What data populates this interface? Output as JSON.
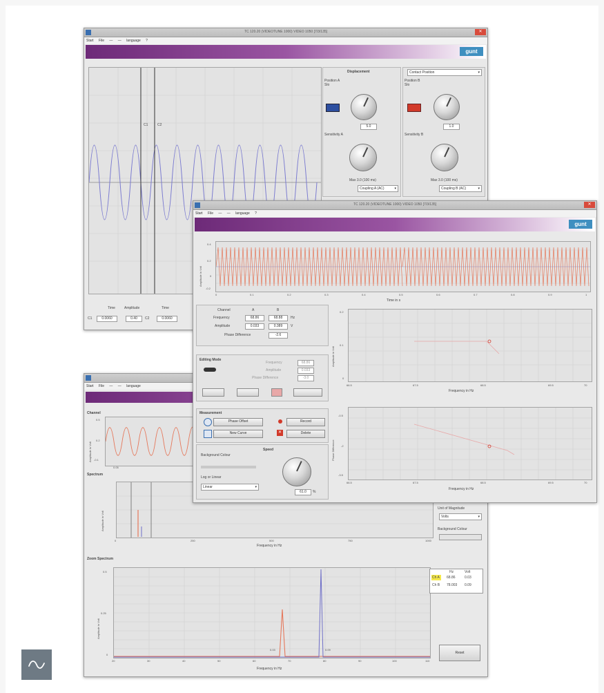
{
  "back_window": {
    "title": "TC 120.20 (VIDEOTUNE 1000) VIDEO 1050 [7/3/135]",
    "menu": [
      "Start",
      "File",
      "",
      "",
      "language",
      "?"
    ],
    "logo": "gunt",
    "displacement_title": "Displacement",
    "contact_title": "Contact Position",
    "position_a_label": "Position A\nSlo",
    "position_b_label": "Position B\nSlo",
    "sensitivity_a_label": "Sensitivity A",
    "sensitivity_b_label": "Sensitivity B",
    "knob_a_value": "5.0",
    "knob_b_value": "1.0",
    "max_label": "Max 3.0 (100 ms)",
    "coupling_a": "Coupling A (AC)",
    "coupling_b": "Coupling B (AC)",
    "time_label": "Time",
    "amplitude_label": "Amplitude",
    "cursor_1_time": "0.0060",
    "cursor_1_amp": "0.40",
    "cursor_2_time": "0.0060",
    "cursor_1_label": "C1",
    "cursor_2_label": "C2",
    "cursor_1_marker": "C1",
    "cursor_2_marker": "C2"
  },
  "middle_window": {
    "title": "TC 120.20 (VIDEOTUNE 1000) VIDEO 1050 [7/3/135]",
    "menu": [
      "Start",
      "File",
      "",
      "",
      "language",
      "?"
    ],
    "logo": "gunt",
    "time_axis_label": "Time in s",
    "time_ylabel": "Amplitude in Volt",
    "time_ticks": [
      "0",
      "0.05",
      "0.1",
      "0.15",
      "0.2",
      "0.25",
      "0.3",
      "0.35",
      "0.4",
      "0.45",
      "0.5",
      "0.55",
      "0.6",
      "0.65",
      "0.7",
      "0.75",
      "0.8",
      "0.85",
      "0.9",
      "0.95",
      "1"
    ],
    "time_yticks": [
      "0.4",
      "0.3",
      "0.2",
      "0.1",
      "0",
      "-0.1",
      "-0.2"
    ],
    "channel_label": "Channel",
    "channel_a": "A",
    "channel_b": "B",
    "frequency_label": "Frequency",
    "freq_a": "68.86",
    "freq_b": "68.88",
    "freq_unit": "Hz",
    "amplitude_label": "Amplitude",
    "amp_a": "0.033",
    "amp_b": "0.389",
    "amp_unit": "V",
    "phase_label": "Phase Difference",
    "phase_value": "-2.6",
    "fitting_title": "Editing Mode",
    "fit_frequency_label": "Frequency",
    "fit_frequency_value": "68.86",
    "fit_amplitude_label": "Amplitude",
    "fit_amplitude_value": "0.033",
    "fit_phase_label": "Phase Difference",
    "fit_phase_value": "-3.0",
    "measurement_title": "Measurement",
    "btn_phase_offset": "Phase Offset",
    "btn_new_curve": "New Curve",
    "btn_record": "Record",
    "btn_delete": "Delete",
    "background_colour_label": "Background Colour",
    "lin_log_label": "Log or Linear",
    "lin_log_value": "Linear",
    "speed_title": "Speed",
    "speed_value": "61.0",
    "speed_unit": "%",
    "amp_plot_ylabel": "Amplitude in Volt",
    "amp_plot_xlabel": "Frequency in Hz",
    "phase_plot_ylabel": "Phase Difference",
    "phase_plot_xlabel": "Frequency in Hz",
    "freq_ticks": [
      "66.5",
      "66.75",
      "67",
      "67.25",
      "67.5",
      "67.75",
      "68",
      "68.25",
      "68.5",
      "68.75",
      "69",
      "69.25",
      "69.5",
      "69.75",
      "70"
    ],
    "amp_yticks": [
      "0.2",
      "0.15",
      "0.1",
      "0.05",
      "0"
    ],
    "phase_yticks": [
      "-0.5",
      "-1",
      "-1.5",
      "-2",
      "-2.5",
      "-3",
      "-3.5"
    ]
  },
  "front_window": {
    "title": "TC 120.20 (VIDEOTUNE 1000) VIDEO 1050 [7/3/135]",
    "menu": [
      "Start",
      "File",
      "",
      "",
      "language",
      "?"
    ],
    "channel_title": "Channel",
    "channel_ylabel": "Amplitude in Volt",
    "channel_yticks": [
      "0.5",
      "0.4",
      "0.3",
      "0.2",
      "0.1",
      "0",
      "-0.1"
    ],
    "channel_xtick_start": "0.05",
    "spectrum_title": "Spectrum",
    "spectrum_ylabel": "Amplitude in Volt",
    "spectrum_xlabel": "Frequency in Hz",
    "spectrum_ticks": [
      "0",
      "50",
      "100",
      "150",
      "200",
      "250",
      "300",
      "350",
      "400",
      "450",
      "500",
      "550",
      "600",
      "650",
      "700",
      "750",
      "800",
      "850",
      "900",
      "950",
      "1000"
    ],
    "unit_magnitude_label": "Unit of Magnitude",
    "unit_magnitude_value": "Volts",
    "background_colour_label": "Background Colour",
    "zoom_title": "Zoom Spectrum",
    "zoom_ylabel": "Amplitude in Volt",
    "zoom_xlabel": "Frequency in Hz",
    "zoom_ticks": [
      "20",
      "30",
      "40",
      "50",
      "60",
      "70",
      "80",
      "90",
      "100",
      "110"
    ],
    "zoom_yticks": [
      "0.5",
      "0.45",
      "0.4",
      "0.35",
      "0.3",
      "0.25",
      "0.2",
      "0.15",
      "0.1",
      "0.05",
      "0"
    ],
    "legend_col_hz": "Hz",
    "legend_col_volt": "Volt",
    "legend_row_a_ch": "Ch A",
    "legend_row_a_hz": "68.86",
    "legend_row_a_volt": "0.03",
    "legend_row_b_ch": "Ch B",
    "legend_row_b_hz": "78.003",
    "legend_row_b_volt": "0.09",
    "reset_button": "Reset",
    "peak_label_a": "0.03",
    "peak_label_b": "0.09"
  },
  "colors": {
    "brand_purple": "#6d2a78",
    "logo_blue": "#3f8fc0",
    "signal_blue": "#6f6fc8",
    "signal_red": "#e5775a",
    "icon_gray": "#6e7a84"
  },
  "icons": {
    "signal": "sine-wave-icon"
  }
}
